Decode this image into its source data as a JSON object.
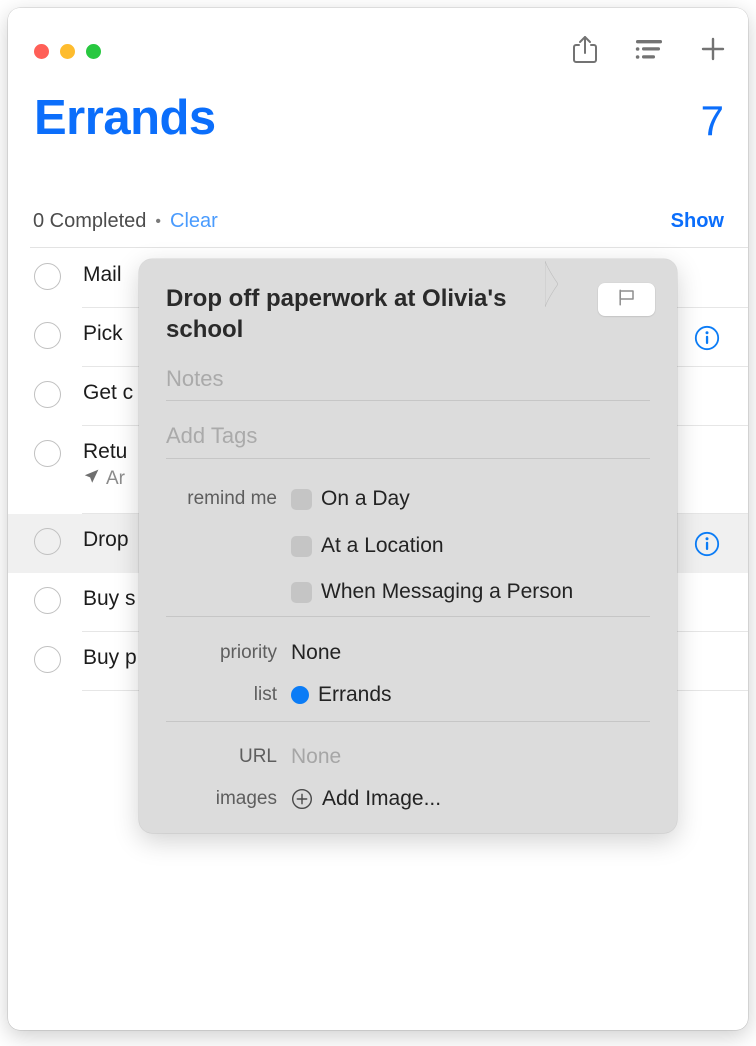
{
  "window": {
    "traffic_lights": [
      "close",
      "minimize",
      "zoom"
    ],
    "colors": {
      "accent_blue": "#0b6efb",
      "link_blue": "#4a9bfd",
      "list_dot_blue": "#0b7cf6",
      "popover_bg": "#dcdcdc",
      "selected_row": "#f0f0f0"
    }
  },
  "toolbar": {
    "share_icon": "share-icon",
    "sort_icon": "list-sort-icon",
    "add_icon": "plus-icon"
  },
  "header": {
    "title": "Errands",
    "count": "7"
  },
  "completed_bar": {
    "completed_text": "0 Completed",
    "separator": "•",
    "clear_label": "Clear",
    "show_label": "Show"
  },
  "tasks": [
    {
      "title": "Mail",
      "subtitle": "",
      "selected": false,
      "has_info": false,
      "height": 59
    },
    {
      "title": "Pick",
      "subtitle": "",
      "selected": false,
      "has_info": true,
      "height": 59
    },
    {
      "title": "Get c",
      "subtitle": "",
      "selected": false,
      "has_info": false,
      "height": 59
    },
    {
      "title": "Retu",
      "subtitle": "Ar",
      "subtitle_icon": "location-arrow-icon",
      "selected": false,
      "has_info": false,
      "height": 88
    },
    {
      "title": "Drop",
      "subtitle": "",
      "selected": true,
      "has_info": true,
      "height": 59
    },
    {
      "title": "Buy s",
      "subtitle": "",
      "selected": false,
      "has_info": false,
      "height": 59
    },
    {
      "title": "Buy p",
      "subtitle": "",
      "selected": false,
      "has_info": false,
      "height": 59
    }
  ],
  "popover": {
    "title": "Drop off paperwork at Olivia's school",
    "flag_icon": "flag-icon",
    "notes_placeholder": "Notes",
    "tags_placeholder": "Add Tags",
    "remind_label": "remind me",
    "remind_options": [
      {
        "label": "On a Day",
        "checked": false
      },
      {
        "label": "At a Location",
        "checked": false
      },
      {
        "label": "When Messaging a Person",
        "checked": false
      }
    ],
    "priority_label": "priority",
    "priority_value": "None",
    "list_label": "list",
    "list_value": "Errands",
    "url_label": "URL",
    "url_value": "None",
    "images_label": "images",
    "images_action": "Add Image...",
    "add_image_icon": "plus-circle-icon"
  }
}
